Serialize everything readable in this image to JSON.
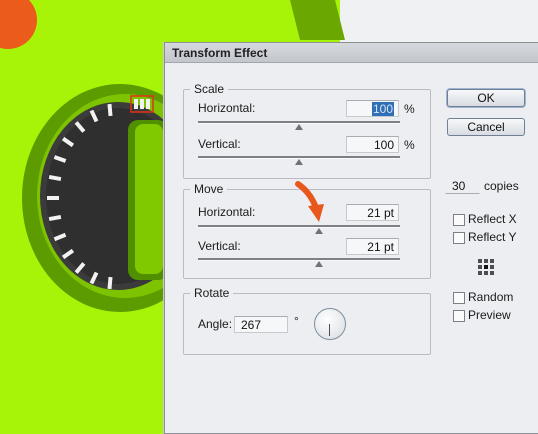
{
  "dialog": {
    "title": "Transform Effect",
    "scale": {
      "legend": "Scale",
      "horizontal_label": "Horizontal:",
      "horizontal_value": "100",
      "horizontal_unit": "%",
      "vertical_label": "Vertical:",
      "vertical_value": "100",
      "vertical_unit": "%"
    },
    "move": {
      "legend": "Move",
      "horizontal_label": "Horizontal:",
      "horizontal_value": "21 pt",
      "vertical_label": "Vertical:",
      "vertical_value": "21 pt"
    },
    "rotate": {
      "legend": "Rotate",
      "angle_label": "Angle:",
      "angle_value": "267",
      "angle_unit": "°"
    },
    "buttons": {
      "ok": "OK",
      "cancel": "Cancel"
    },
    "copies": {
      "value": "30",
      "label": "copies"
    },
    "options": {
      "reflect_x": {
        "label": "Reflect X",
        "checked": false
      },
      "reflect_y": {
        "label": "Reflect Y",
        "checked": false
      },
      "random": {
        "label": "Random",
        "checked": false
      },
      "preview": {
        "label": "Preview",
        "checked": false
      }
    }
  },
  "colors": {
    "background_green": "#a7f408",
    "dark_green": "#5a9e00",
    "mid_green": "#7ec300",
    "dial_gray": "#3f3f3f",
    "arrow_orange": "#e8581c",
    "selection_red": "#e5301b"
  },
  "icons": [
    "reference-point-icon",
    "angle-dial-icon",
    "orange-arrow-icon"
  ]
}
